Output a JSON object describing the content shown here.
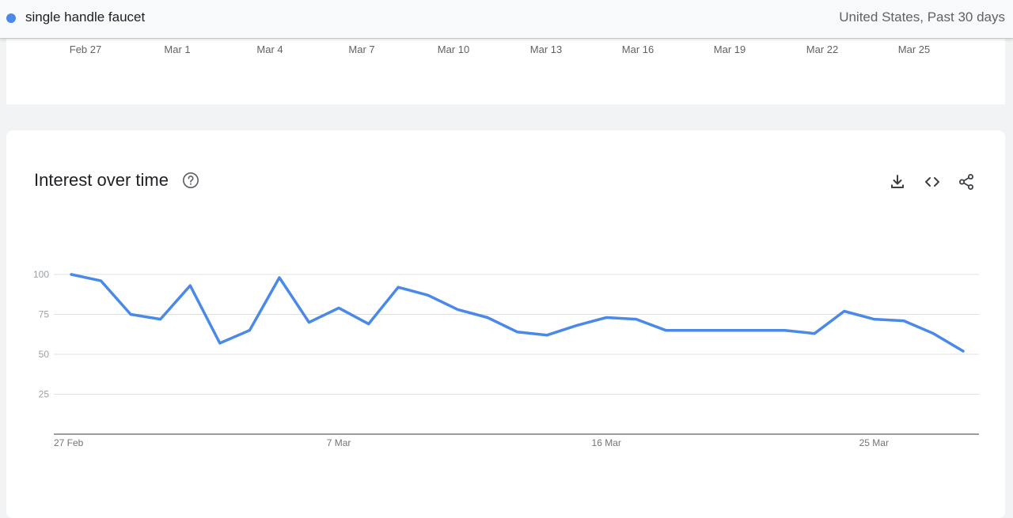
{
  "header": {
    "term": "single handle faucet",
    "region": "United States, Past 30 days"
  },
  "upper_axis": {
    "labels": [
      "Feb 27",
      "Mar 1",
      "Mar 4",
      "Mar 7",
      "Mar 10",
      "Mar 13",
      "Mar 16",
      "Mar 19",
      "Mar 22",
      "Mar 25"
    ]
  },
  "card": {
    "title": "Interest over time",
    "help_icon": "help-circle-icon",
    "actions": [
      "download-icon",
      "embed-code-icon",
      "share-icon"
    ]
  },
  "colors": {
    "series": "#4a89e8",
    "grid": "#e0e0e0",
    "axis": "#5f6368",
    "tick_text": "#70757a"
  },
  "chart_data": {
    "type": "line",
    "title": "Interest over time",
    "xlabel": "",
    "ylabel": "",
    "ylim": [
      0,
      100
    ],
    "yticks": [
      25,
      50,
      75,
      100
    ],
    "xtick_labels": [
      {
        "label": "27 Feb",
        "index": 0
      },
      {
        "label": "7 Mar",
        "index": 9
      },
      {
        "label": "16 Mar",
        "index": 18
      },
      {
        "label": "25 Mar",
        "index": 27
      }
    ],
    "grid": true,
    "series": [
      {
        "x": [
          "27 Feb",
          "28 Feb",
          "1 Mar",
          "2 Mar",
          "3 Mar",
          "4 Mar",
          "5 Mar",
          "6 Mar",
          "7 Mar",
          "8 Mar",
          "9 Mar",
          "10 Mar",
          "11 Mar",
          "12 Mar",
          "13 Mar",
          "14 Mar",
          "15 Mar",
          "16 Mar",
          "17 Mar",
          "18 Mar",
          "19 Mar",
          "20 Mar",
          "21 Mar",
          "22 Mar",
          "23 Mar",
          "24 Mar",
          "25 Mar",
          "26 Mar",
          "27 Mar",
          "28 Mar",
          "29 Mar"
        ],
        "values": [
          100,
          96,
          75,
          72,
          93,
          57,
          65,
          98,
          70,
          79,
          69,
          92,
          87,
          78,
          73,
          64,
          62,
          68,
          73,
          72,
          65,
          65,
          65,
          65,
          65,
          63,
          77,
          72,
          71,
          63,
          52
        ]
      }
    ]
  }
}
